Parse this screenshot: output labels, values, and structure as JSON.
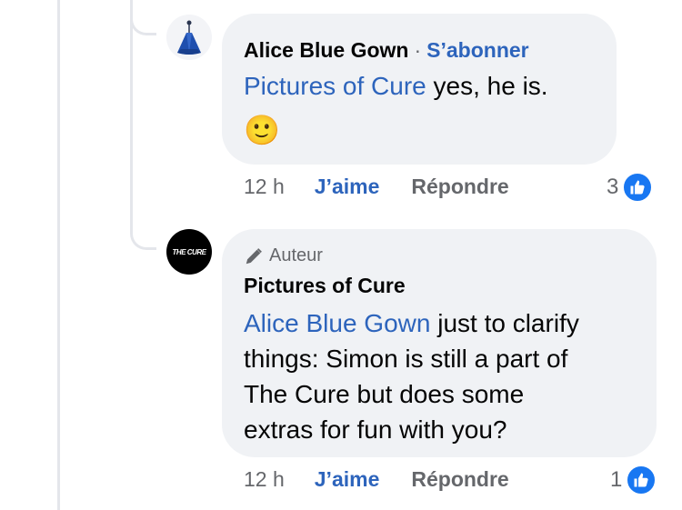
{
  "comments": [
    {
      "author": "Alice Blue Gown",
      "separator": "·",
      "follow_label": "S’abonner",
      "mention": "Pictures of Cure",
      "text": " yes, he is.",
      "emoji": "🙂",
      "time": "12 h",
      "like_label": "J’aime",
      "reply_label": "Répondre",
      "reaction_count": "3",
      "avatar_icon": "gown-illustration-icon"
    },
    {
      "badge_label": "Auteur",
      "badge_icon": "pen-icon",
      "author": "Pictures of Cure",
      "mention": "Alice Blue Gown",
      "text_line1": " just to clarify",
      "text_line2": "things: Simon is still a part of",
      "text_line3": "The Cure but does some",
      "text_line4": "extras for fun with you?",
      "time": "12 h",
      "like_label": "J’aime",
      "reply_label": "Répondre",
      "reaction_count": "1",
      "avatar_text": "THE CURE"
    }
  ],
  "colors": {
    "bubble": "#f0f2f5",
    "link": "#2d64bc",
    "meta": "#65676b",
    "like_badge": "#1877f2"
  }
}
